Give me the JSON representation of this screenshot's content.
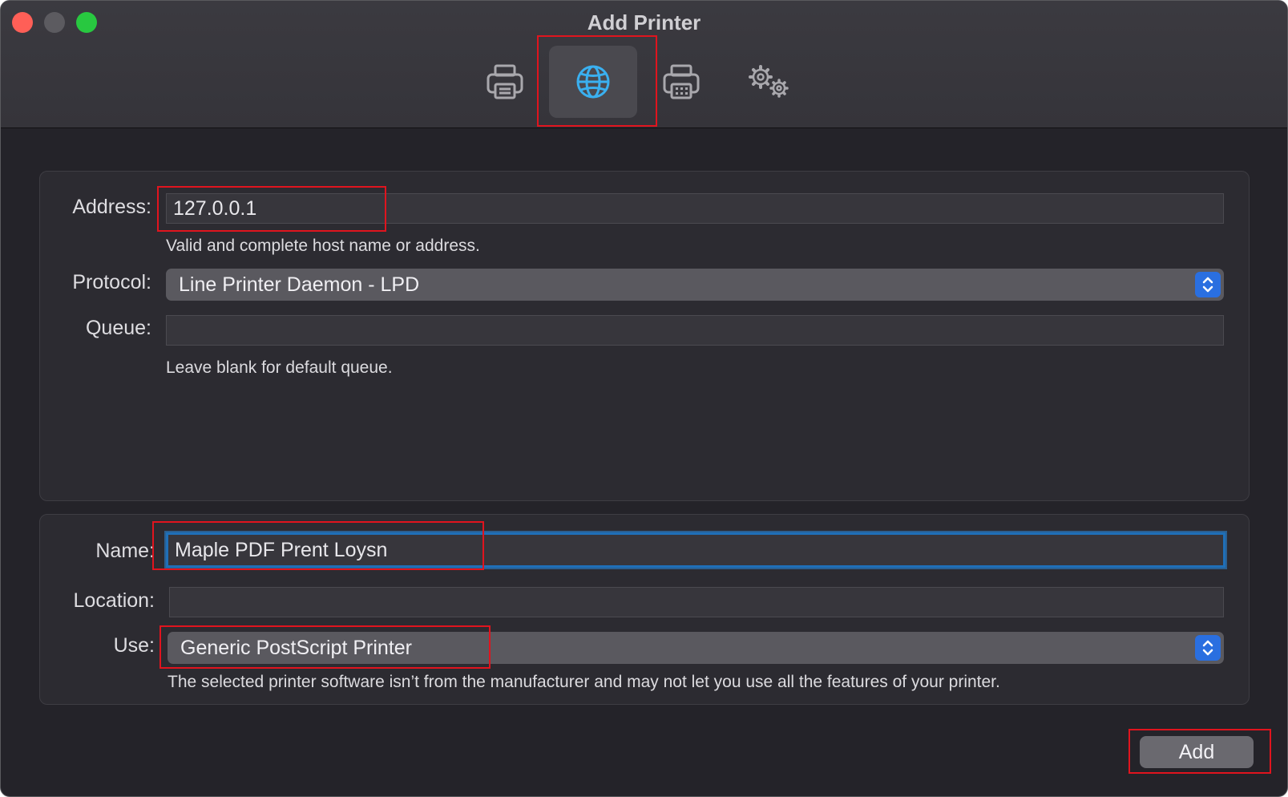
{
  "window": {
    "title": "Add Printer"
  },
  "toolbar": {
    "items": [
      {
        "icon": "printer-icon"
      },
      {
        "icon": "globe-icon",
        "selected": true
      },
      {
        "icon": "fax-printer-icon"
      },
      {
        "icon": "gears-icon"
      }
    ]
  },
  "ip_form": {
    "address_label": "Address:",
    "address_value": "127.0.0.1",
    "address_hint": "Valid and complete host name or address.",
    "protocol_label": "Protocol:",
    "protocol_value": "Line Printer Daemon - LPD",
    "queue_label": "Queue:",
    "queue_value": "",
    "queue_hint": "Leave blank for default queue."
  },
  "printer_form": {
    "name_label": "Name:",
    "name_value": "Maple PDF Prent Loysn",
    "location_label": "Location:",
    "location_value": "",
    "use_label": "Use:",
    "use_value": "Generic PostScript Printer",
    "use_hint": "The selected printer software isn’t from the manufacturer and may not let you use all the features of your printer."
  },
  "actions": {
    "add_label": "Add"
  },
  "colors": {
    "accent": "#3ab0f0",
    "highlight": "#e0141e",
    "stepper": "#2a6fe0"
  }
}
